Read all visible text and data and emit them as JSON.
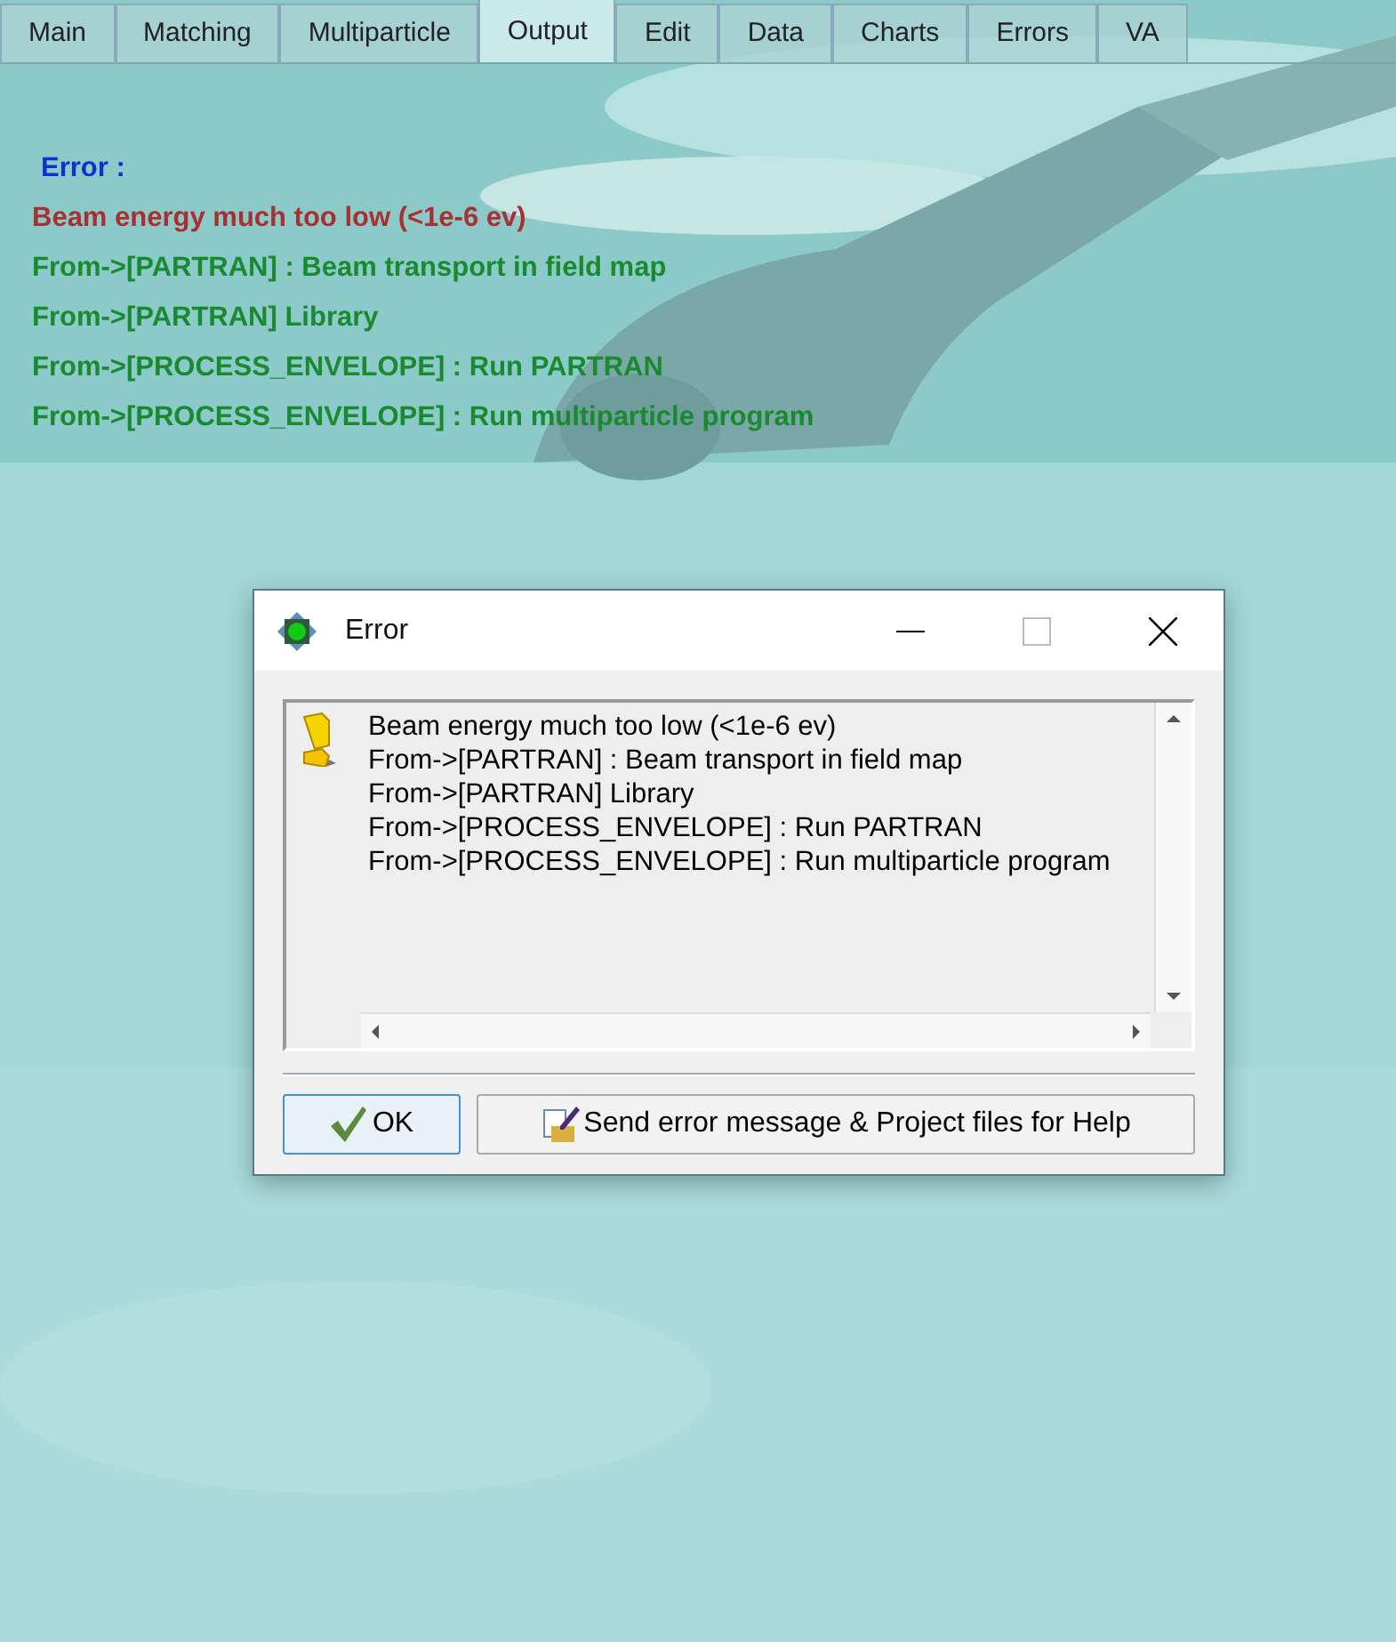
{
  "tabs": [
    {
      "label": "Main",
      "selected": false
    },
    {
      "label": "Matching",
      "selected": false
    },
    {
      "label": "Multiparticle",
      "selected": false
    },
    {
      "label": "Output",
      "selected": true
    },
    {
      "label": "Edit",
      "selected": false
    },
    {
      "label": "Data",
      "selected": false
    },
    {
      "label": "Charts",
      "selected": false
    },
    {
      "label": "Errors",
      "selected": false
    },
    {
      "label": "VA",
      "selected": false
    }
  ],
  "output": {
    "lines": [
      {
        "kind": "heading",
        "text": "Error :"
      },
      {
        "kind": "error",
        "text": "Beam energy much too low (<1e-6 ev)"
      },
      {
        "kind": "trace",
        "text": "From->[PARTRAN] : Beam transport in field map"
      },
      {
        "kind": "trace",
        "text": "From->[PARTRAN] Library"
      },
      {
        "kind": "trace",
        "text": "From->[PROCESS_ENVELOPE] : Run PARTRAN"
      },
      {
        "kind": "trace",
        "text": "From->[PROCESS_ENVELOPE] : Run multiparticle program"
      }
    ]
  },
  "dialog": {
    "title": "Error",
    "message_lines": [
      "Beam energy much too low (<1e-6 ev)",
      "From->[PARTRAN] : Beam transport in field map",
      "From->[PARTRAN] Library",
      "From->[PROCESS_ENVELOPE] : Run PARTRAN",
      "From->[PROCESS_ENVELOPE] : Run multiparticle program"
    ],
    "buttons": [
      {
        "kind": "ok",
        "label": "OK"
      },
      {
        "kind": "send",
        "label": "Send error message & Project files for Help"
      }
    ]
  }
}
